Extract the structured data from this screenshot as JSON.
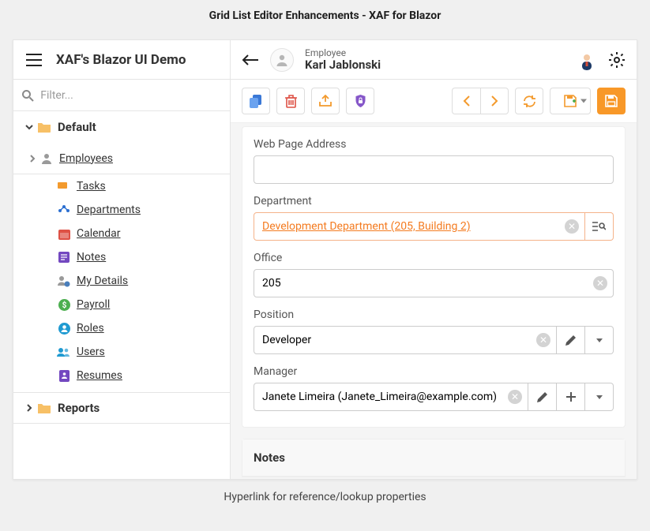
{
  "page_heading": "Grid List Editor Enhancements - XAF for Blazor",
  "app_title": "XAF's Blazor UI Demo",
  "filter_placeholder": "Filter...",
  "sidebar": {
    "groups": [
      {
        "label": "Default",
        "expanded": true
      },
      {
        "label": "Reports",
        "expanded": false
      }
    ],
    "employees_label": "Employees",
    "items": [
      {
        "label": "Tasks",
        "icon": "tasks-icon",
        "color": "c-orange"
      },
      {
        "label": "Departments",
        "icon": "departments-icon",
        "color": "c-blue"
      },
      {
        "label": "Calendar",
        "icon": "calendar-icon",
        "color": "c-red"
      },
      {
        "label": "Notes",
        "icon": "notes-icon",
        "color": "c-purple"
      },
      {
        "label": "My Details",
        "icon": "my-details-icon",
        "color": "c-gray"
      },
      {
        "label": "Payroll",
        "icon": "payroll-icon",
        "color": "c-green"
      },
      {
        "label": "Roles",
        "icon": "roles-icon",
        "color": "c-teal"
      },
      {
        "label": "Users",
        "icon": "users-icon",
        "color": "c-teal"
      },
      {
        "label": "Resumes",
        "icon": "resumes-icon",
        "color": "c-purple"
      }
    ]
  },
  "header": {
    "type": "Employee",
    "name": "Karl Jablonski"
  },
  "form": {
    "web_page_address": {
      "label": "Web Page Address",
      "value": ""
    },
    "department": {
      "label": "Department",
      "value": "Development Department (205, Building 2)"
    },
    "office": {
      "label": "Office",
      "value": "205"
    },
    "position": {
      "label": "Position",
      "value": "Developer"
    },
    "manager": {
      "label": "Manager",
      "value": "Janete Limeira (Janete_Limeira@example.com)"
    },
    "notes_label": "Notes"
  },
  "footer_text": "Hyperlink for reference/lookup properties",
  "colors": {
    "accent": "#f89828"
  }
}
